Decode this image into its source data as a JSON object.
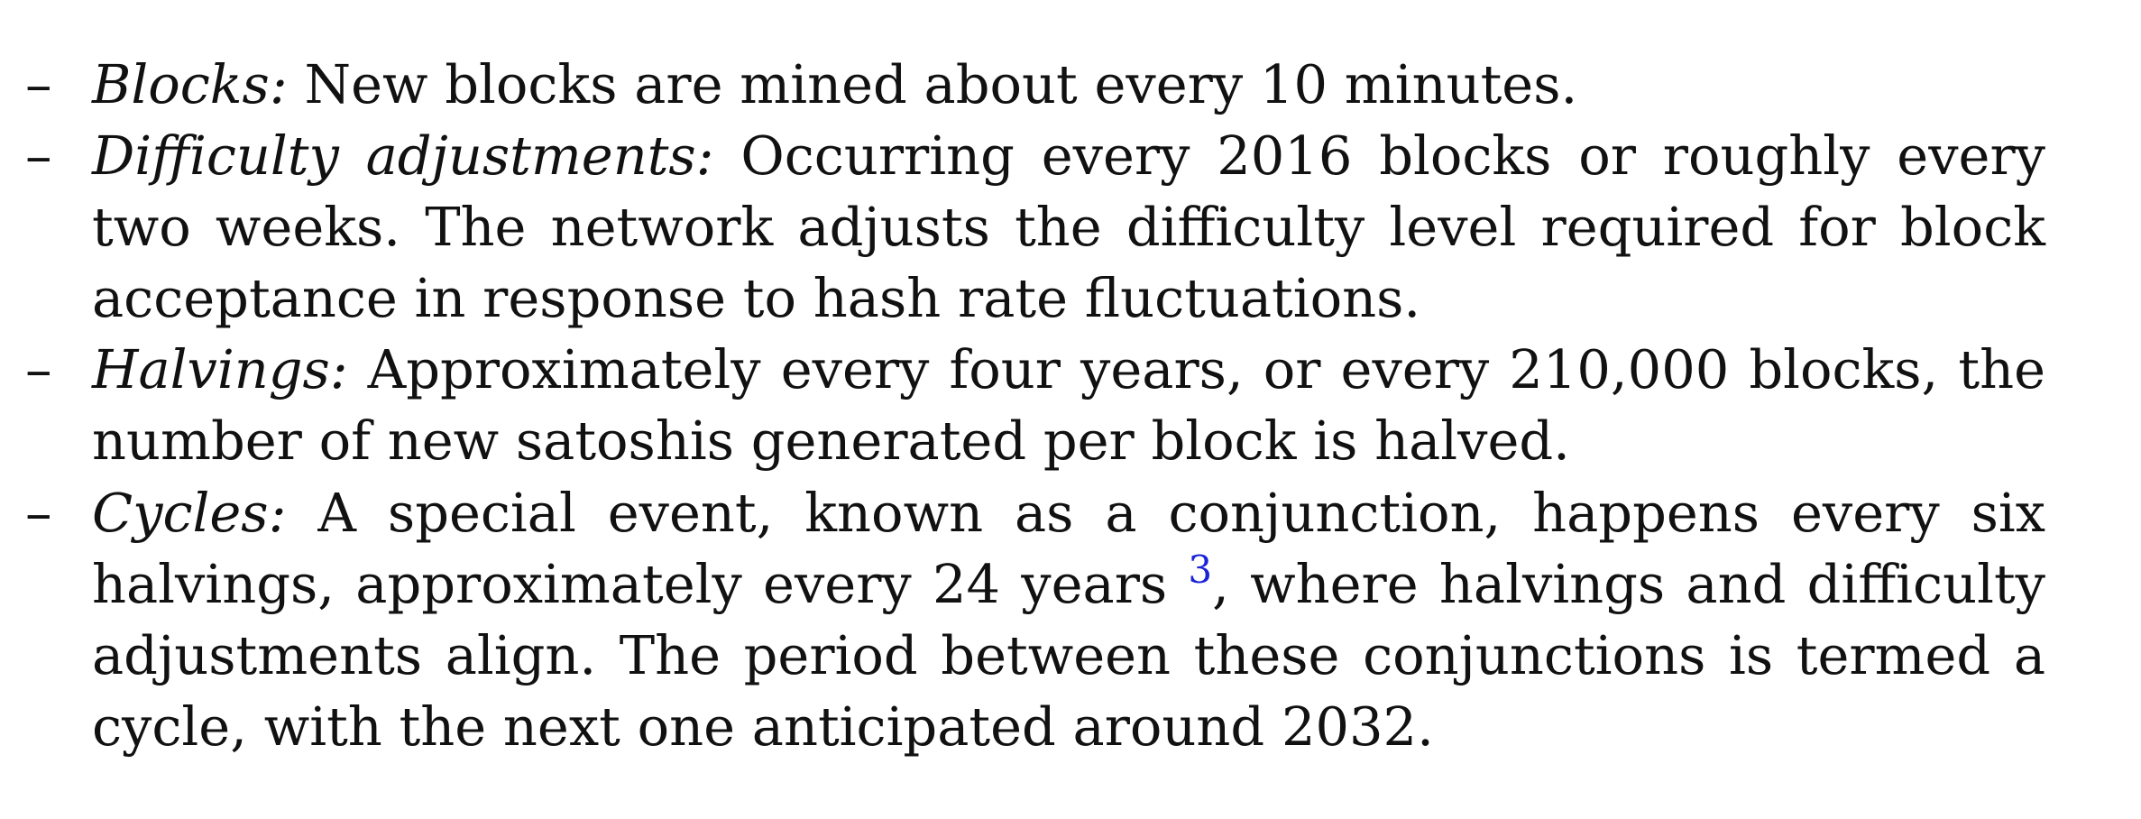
{
  "list_marker": "–",
  "items": [
    {
      "term": "Blocks:",
      "text": " New blocks are mined about every 10 minutes."
    },
    {
      "term": "Difficulty adjustments:",
      "text": " Occurring every 2016 blocks or roughly every two weeks. The network adjusts the difficulty level required for block acceptance in response to hash rate fluctuations."
    },
    {
      "term": "Halvings:",
      "text": " Approximately every four years, or every 210,000 blocks, the num­ber of new satoshis generated per block is halved."
    },
    {
      "term": "Cycles:",
      "text_before": " A special event, known as a conjunction, happens every six halvings, approximately every 24 years ",
      "footnote": "3",
      "text_after": ", where halvings and difficulty adjustments align. The period between these conjunctions is termed a cycle, with the next one anticipated around 2032."
    }
  ],
  "colors": {
    "text": "#111111",
    "footnote_link": "#1a23d6"
  }
}
